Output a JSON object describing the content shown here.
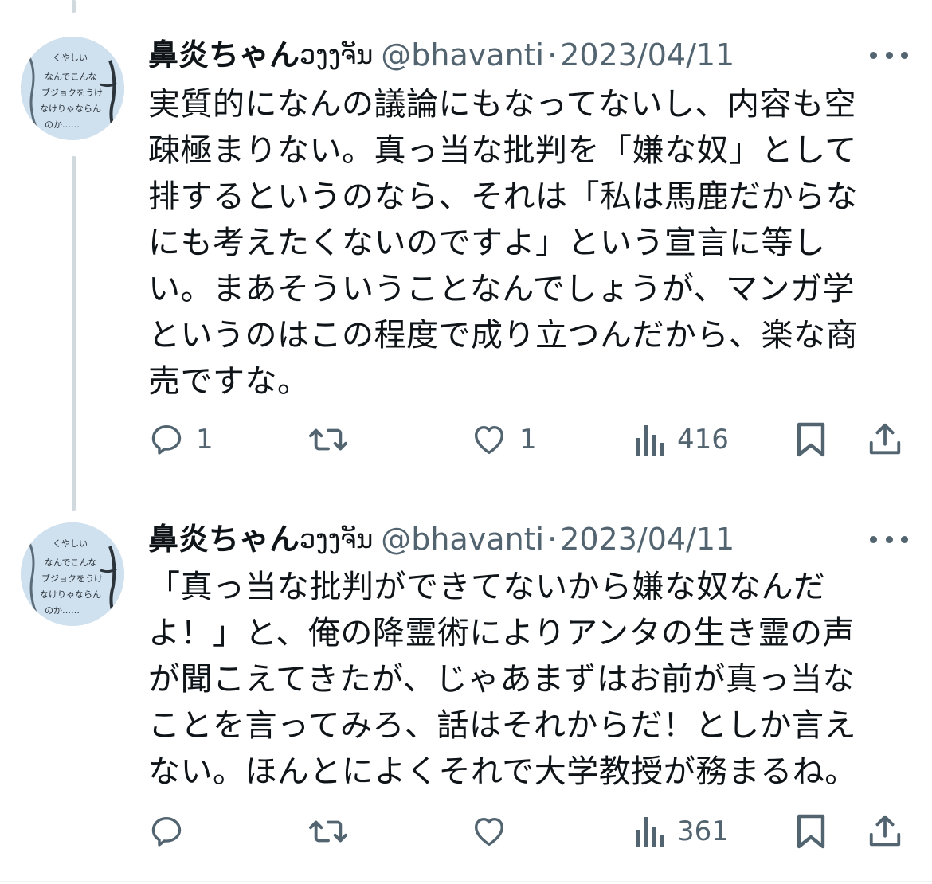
{
  "tweets": [
    {
      "display_name": "鼻炎ちゃん",
      "name_suffix": "ວງງຈັນ",
      "handle": "@bhavanti",
      "separator": "·",
      "date": "2023/04/11",
      "avatar_text": [
        "くやしい",
        "なんでこんな",
        "ブジョクをうけ",
        "なけりゃならん",
        "のか……"
      ],
      "body": "実質的になんの議論にもなってないし、内容も空\n疎極まりない。真っ当な批判を「嫌な奴」として\n排するというのなら、それは「私は馬鹿だからな\nにも考えたくないのですよ」という宣言に等し\nい。まあそういうことなんでしょうが、マンガ学\nというのはこの程度で成り立つんだから、楽な商\n売ですな。",
      "reply_count": "1",
      "retweet_count": "",
      "like_count": "1",
      "view_count": "416",
      "icons": [
        "reply-icon",
        "retweet-icon",
        "like-icon",
        "views-icon",
        "bookmark-icon",
        "share-icon"
      ]
    },
    {
      "display_name": "鼻炎ちゃん",
      "name_suffix": "ວງງຈັນ",
      "handle": "@bhavanti",
      "separator": "·",
      "date": "2023/04/11",
      "avatar_text": [
        "くやしい",
        "なんでこんな",
        "ブジョクをうけ",
        "なけりゃならん",
        "のか……"
      ],
      "body": "「真っ当な批判ができてないから嫌な奴なんだ\nよ！」と、俺の降霊術によりアンタの生き霊の声\nが聞こえてきたが、じゃあまずはお前が真っ当な\nことを言ってみろ、話はそれからだ！としか言え\nない。ほんとによくそれで大学教授が務まるね。",
      "reply_count": "",
      "retweet_count": "",
      "like_count": "",
      "view_count": "361",
      "icons": [
        "reply-icon",
        "retweet-icon",
        "like-icon",
        "views-icon",
        "bookmark-icon",
        "share-icon"
      ]
    }
  ],
  "colors": {
    "text": "#0f1419",
    "secondary": "#536471",
    "thread_line": "#cfd9de",
    "avatar_bg": "#cfe0ee"
  }
}
